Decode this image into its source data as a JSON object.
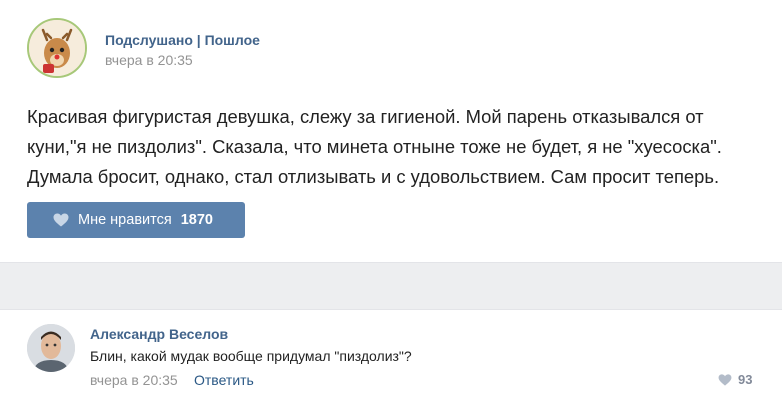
{
  "post": {
    "group_name": "Подслушано | Пошлое",
    "time": "вчера в 20:35",
    "text_lines": [
      "Красивая фигуристая девушка, слежу за гигиеной. Мой парень отказывался от",
      "куни,\"я не пиздолиз\". Сказала, что минета отныне тоже не будет, я не \"хуесоска\".",
      "Думала бросит, однако, стал отлизывать и с удовольствием. Сам просит теперь."
    ],
    "like_label": "Мне нравится",
    "like_count": "1870"
  },
  "comment": {
    "author": "Александр Веселов",
    "text": "Блин, какой мудак вообще придумал \"пиздолиз\"?",
    "time": "вчера в 20:35",
    "reply_label": "Ответить",
    "like_count": "93"
  },
  "colors": {
    "accent": "#5c82ad",
    "link": "#42648b",
    "muted": "#939393"
  }
}
